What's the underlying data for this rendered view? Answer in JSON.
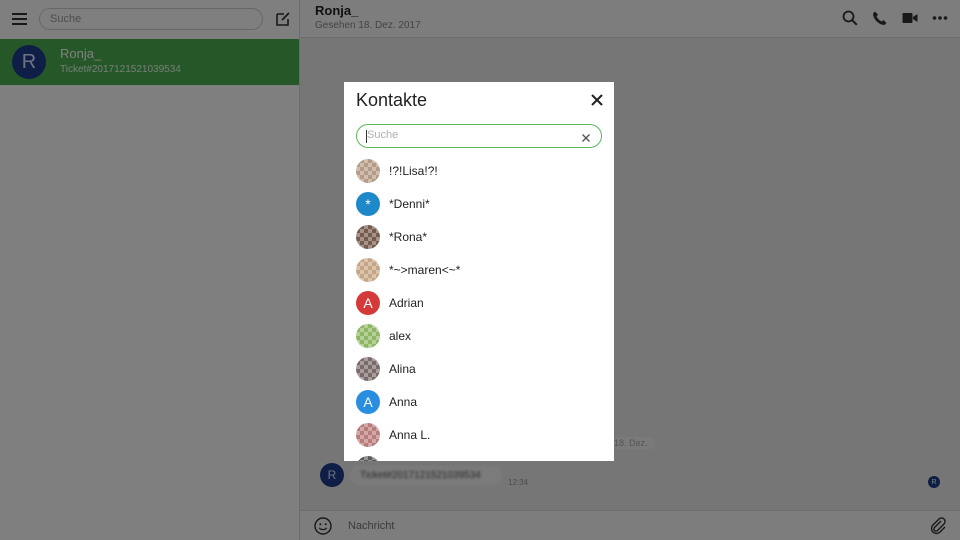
{
  "sidebar": {
    "search_placeholder": "Suche",
    "chat": {
      "avatar_letter": "R",
      "name": "Ronja_",
      "subtitle": "Ticket#2017121521039534"
    }
  },
  "conversation": {
    "title": "Ronja_",
    "subtitle": "Gesehen 18. Dez. 2017",
    "date_chip": "18. Dez.",
    "message": {
      "avatar_letter": "R",
      "text": "Ticket#2017121521039534",
      "time": "12:34"
    },
    "read_indicator": "R",
    "composer_placeholder": "Nachricht"
  },
  "dialog": {
    "title": "Kontakte",
    "search_placeholder": "Suche",
    "contacts": [
      {
        "name": "!?!Lisa!?!",
        "avatar": "photo",
        "color": "#b89a82"
      },
      {
        "name": "*Denni*",
        "avatar": "letter",
        "letter": "*",
        "color": "#1e88c8"
      },
      {
        "name": "*Rona*",
        "avatar": "photo",
        "color": "#7a5a4c"
      },
      {
        "name": "*~>maren<~*",
        "avatar": "photo",
        "color": "#c8a680"
      },
      {
        "name": "Adrian",
        "avatar": "letter",
        "letter": "A",
        "color": "#d53a3a"
      },
      {
        "name": "alex",
        "avatar": "photo",
        "color": "#8cb85c"
      },
      {
        "name": "Alina",
        "avatar": "photo",
        "color": "#7c6a6a"
      },
      {
        "name": "Anna",
        "avatar": "letter",
        "letter": "A",
        "color": "#2a8ee0"
      },
      {
        "name": "Anna L.",
        "avatar": "photo",
        "color": "#c07a7a"
      },
      {
        "name": "",
        "avatar": "photo",
        "color": "#5a5a5a"
      }
    ]
  }
}
